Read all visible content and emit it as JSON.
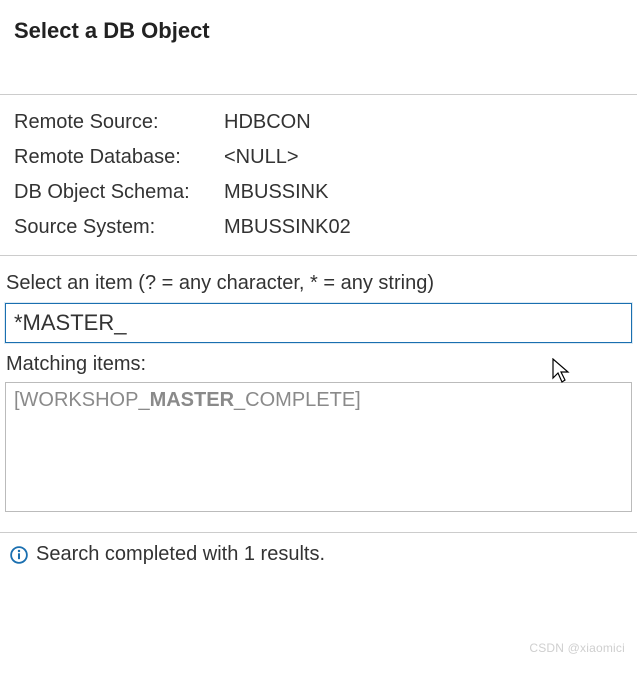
{
  "dialog": {
    "title": "Select a DB Object"
  },
  "info": {
    "remote_source_label": "Remote Source:",
    "remote_source_value": "HDBCON",
    "remote_database_label": "Remote Database:",
    "remote_database_value": "<NULL>",
    "db_object_schema_label": "DB Object Schema:",
    "db_object_schema_value": "MBUSSINK",
    "source_system_label": "Source System:",
    "source_system_value": "MBUSSINK02"
  },
  "filter": {
    "label": "Select an item (? = any character, * = any string)",
    "value": "*MASTER_"
  },
  "matching": {
    "label": "Matching items:",
    "items": [
      {
        "prefix": "[WORKSHOP_",
        "match": "MASTER",
        "suffix": "_COMPLETE]"
      }
    ]
  },
  "status": {
    "text": "Search completed with 1 results."
  },
  "watermark": "CSDN @xiaomici"
}
